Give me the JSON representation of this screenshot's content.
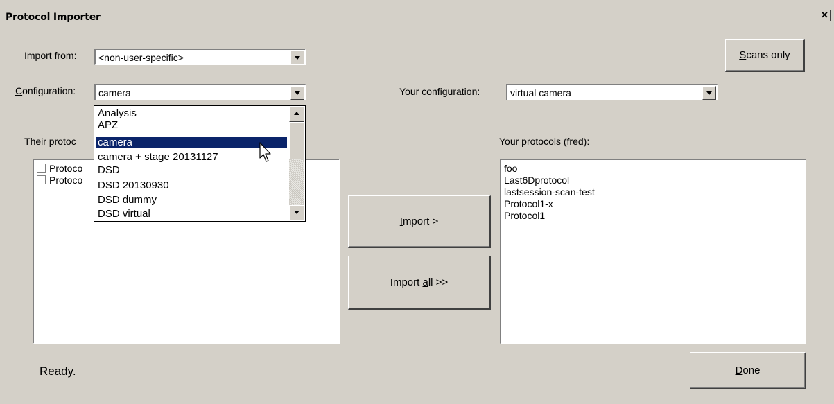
{
  "window": {
    "title": "Protocol Importer",
    "close_glyph": "✕"
  },
  "import_from": {
    "label_pre": "Import ",
    "label_key": "f",
    "label_post": "rom:",
    "value": "<non-user-specific>"
  },
  "configuration": {
    "label_pre": "",
    "label_key": "C",
    "label_post": "onfiguration:",
    "value": "camera",
    "options": [
      "Analysis",
      "APZ",
      "camera",
      "camera + stage 20131127",
      "DSD",
      "DSD 20130930",
      "DSD dummy",
      "DSD virtual"
    ],
    "selected_index": 2
  },
  "your_configuration": {
    "label_pre": "",
    "label_key": "Y",
    "label_post": "our configuration:",
    "value": "virtual camera"
  },
  "scans_only": {
    "label_pre": "",
    "label_key": "S",
    "label_post": "cans only"
  },
  "their_protocols": {
    "label_pre": "",
    "label_key": "T",
    "label_post": "heir protoc",
    "items": [
      "Protoco",
      "Protoco"
    ]
  },
  "your_protocols": {
    "label": "Your protocols (fred):",
    "items": [
      "foo",
      "Last6Dprotocol",
      "lastsession-scan-test",
      "Protocol1-x",
      "Protocol1"
    ]
  },
  "import_button": {
    "label_pre": "",
    "label_key": "I",
    "label_post": "mport >"
  },
  "import_all_button": {
    "label_pre": "Import ",
    "label_key": "a",
    "label_post": "ll >>"
  },
  "done_button": {
    "label_pre": "",
    "label_key": "D",
    "label_post": "one"
  },
  "status": {
    "text": "Ready."
  },
  "colors": {
    "background": "#d4d0c8",
    "selection": "#0a246a"
  },
  "icons": {
    "cursor": "mouse-pointer-icon"
  }
}
